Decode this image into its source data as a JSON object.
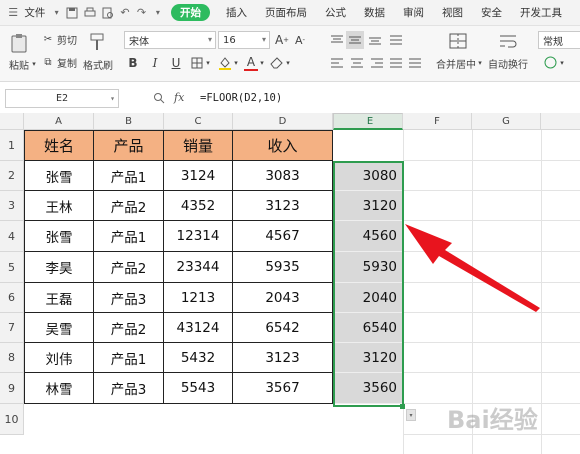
{
  "menubar": {
    "items": [
      "文件",
      "开始",
      "插入",
      "页面布局",
      "公式",
      "数据",
      "审阅",
      "视图",
      "安全",
      "开发工具"
    ]
  },
  "toolbar": {
    "paste_label": "粘贴",
    "cut_label": "剪切",
    "copy_label": "复制",
    "format_painter_label": "格式刷",
    "font_name": "宋体",
    "font_size": "16",
    "merge_center_label": "合并居中",
    "wrap_text_label": "自动换行",
    "number_format": "常规"
  },
  "formula_bar": {
    "name_box": "E2",
    "fx_label": "fx",
    "formula": "=FLOOR(D2,10)"
  },
  "sheet": {
    "columns": [
      "A",
      "B",
      "C",
      "D",
      "E",
      "F",
      "G"
    ],
    "rows": [
      "1",
      "2",
      "3",
      "4",
      "5",
      "6",
      "7",
      "8",
      "9",
      "10"
    ],
    "headers": [
      "姓名",
      "产品",
      "销量",
      "收入"
    ],
    "data": [
      [
        "张雪",
        "产品1",
        "3124",
        "3083",
        "3080"
      ],
      [
        "王林",
        "产品2",
        "4352",
        "3123",
        "3120"
      ],
      [
        "张雪",
        "产品1",
        "12314",
        "4567",
        "4560"
      ],
      [
        "李昊",
        "产品2",
        "23344",
        "5935",
        "5930"
      ],
      [
        "王磊",
        "产品3",
        "1213",
        "2043",
        "2040"
      ],
      [
        "吴雪",
        "产品2",
        "43124",
        "6542",
        "6540"
      ],
      [
        "刘伟",
        "产品1",
        "5432",
        "3123",
        "3120"
      ],
      [
        "林雪",
        "产品3",
        "5543",
        "3567",
        "3560"
      ]
    ]
  },
  "watermark": "Bai经验",
  "colors": {
    "header_fill": "#f4b183",
    "selection_border": "#2e9c4f",
    "arrow": "#e8141e",
    "active_tab": "#2dbb5f"
  }
}
